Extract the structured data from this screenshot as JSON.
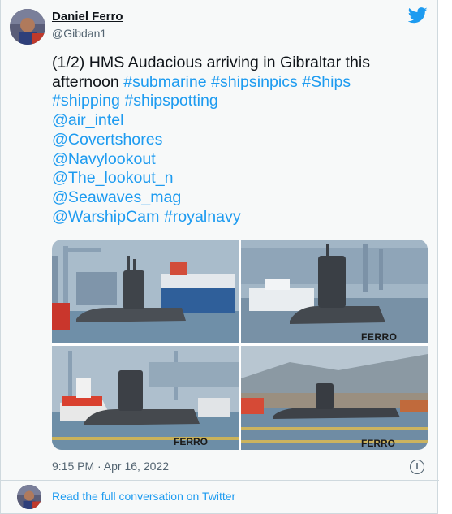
{
  "author": {
    "name": "Daniel Ferro",
    "handle": "@Gibdan1"
  },
  "tweet": {
    "intro": "(1/2) HMS Audacious arriving in Gibraltar this afternoon ",
    "hashtags_line1": [
      "#submarine",
      "#shipsinpics",
      "#Ships"
    ],
    "hashtags_line2": [
      "#shipping",
      "#shipspotting"
    ],
    "mentions": [
      "@air_intel",
      "@Covertshores",
      "@Navylookout",
      "@The_lookout_n",
      "@Seawaves_mag",
      "@WarshipCam"
    ],
    "last_hashtag": "#royalnavy"
  },
  "media": {
    "watermarks": [
      "FERRO",
      "FERRO",
      "FERRO"
    ]
  },
  "timestamp": "9:15 PM · Apr 16, 2022",
  "info_icon_glyph": "i",
  "footer": {
    "read_link": "Read the full conversation on Twitter"
  },
  "icons": [
    "twitter-bird-icon",
    "info-icon"
  ],
  "colors": {
    "link": "#1d9bf0",
    "text": "#0f1419",
    "secondary": "#536471",
    "card_bg": "#f7f9f9"
  }
}
